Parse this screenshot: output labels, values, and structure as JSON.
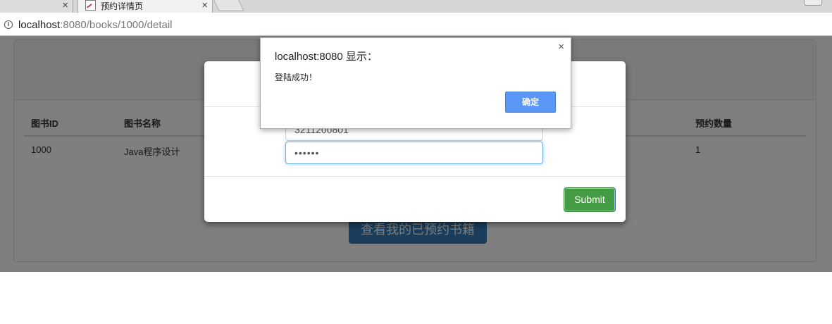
{
  "browser": {
    "tabs": [
      {
        "label": ""
      },
      {
        "label": "预约详情页",
        "close": "×"
      }
    ],
    "prev_tab_close": "×",
    "url_host": "localhost",
    "url_rest": ":8080/books/1000/detail"
  },
  "table": {
    "headers": {
      "book_id": "图书ID",
      "book_name": "图书名称",
      "quantity": "预约数量"
    },
    "row": {
      "book_id": "1000",
      "book_name": "Java程序设计",
      "quantity": "1"
    }
  },
  "page_button_label": "查看我的已预约书籍",
  "modal": {
    "user_value": "3211200801",
    "password_mask": "••••••",
    "submit_label": "Submit"
  },
  "alert": {
    "title": "localhost:8080 显示：",
    "close": "×",
    "message": "登陆成功！",
    "ok_label": "确定"
  }
}
